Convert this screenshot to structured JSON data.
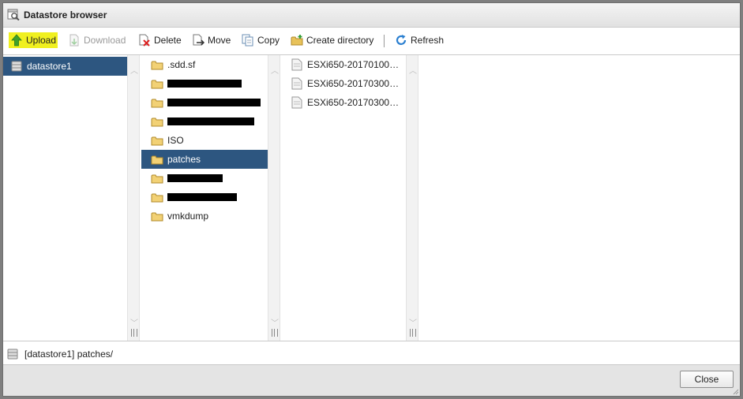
{
  "window": {
    "title": "Datastore browser"
  },
  "toolbar": {
    "upload": "Upload",
    "download": "Download",
    "delete": "Delete",
    "move": "Move",
    "copy": "Copy",
    "create_directory": "Create directory",
    "refresh": "Refresh"
  },
  "datastores": [
    {
      "label": "datastore1",
      "selected": true
    }
  ],
  "folders": [
    {
      "label": ".sdd.sf",
      "redacted": false,
      "selected": false
    },
    {
      "label": "",
      "redacted": true,
      "selected": false
    },
    {
      "label": "",
      "redacted": true,
      "selected": false
    },
    {
      "label": "",
      "redacted": true,
      "selected": false
    },
    {
      "label": "ISO",
      "redacted": false,
      "selected": false
    },
    {
      "label": "patches",
      "redacted": false,
      "selected": true
    },
    {
      "label": "",
      "redacted": true,
      "selected": false
    },
    {
      "label": "",
      "redacted": true,
      "selected": false
    },
    {
      "label": "vmkdump",
      "redacted": false,
      "selected": false
    }
  ],
  "files": [
    {
      "label": "ESXi650-20170100…"
    },
    {
      "label": "ESXi650-20170300…"
    },
    {
      "label": "ESXi650-20170300…"
    }
  ],
  "status": {
    "path": "[datastore1] patches/"
  },
  "footer": {
    "close_label": "Close"
  },
  "colors": {
    "selection": "#2d5680",
    "upload_highlight": "#f0f020",
    "folder": "#e8c25a"
  },
  "icons": {
    "title": "datastore-browser-icon",
    "upload": "upload-arrow-icon",
    "download": "download-icon",
    "delete": "delete-icon",
    "move": "move-icon",
    "copy": "copy-icon",
    "create_directory": "create-folder-icon",
    "refresh": "refresh-icon",
    "datastore": "datastore-icon",
    "folder": "folder-icon",
    "file": "file-icon"
  }
}
